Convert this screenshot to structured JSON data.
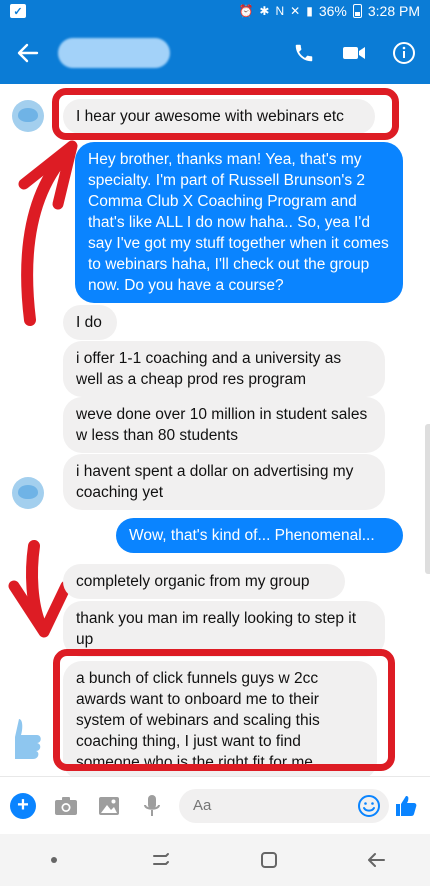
{
  "status_bar": {
    "battery": "36%",
    "time": "3:28 PM"
  },
  "header": {
    "contact_name_hidden": true,
    "icons": [
      "back-arrow-icon",
      "phone-icon",
      "video-camera-icon",
      "info-icon"
    ]
  },
  "messages": [
    {
      "direction": "incoming",
      "text": "I hear your awesome with webinars etc"
    },
    {
      "direction": "outgoing",
      "text": "Hey brother, thanks man!  Yea, that's my specialty.  I'm part of Russell Brunson's 2 Comma Club X Coaching Program and that's like ALL I do now haha..  So, yea I'd say I've got my stuff together when it comes to webinars haha, I'll check out the group now.  Do you have a course?"
    },
    {
      "direction": "incoming",
      "text": "I do"
    },
    {
      "direction": "incoming",
      "text": "i offer 1-1 coaching and a university as well as a cheap prod res program"
    },
    {
      "direction": "incoming",
      "text": "weve done over 10 million in student sales w less than 80 students"
    },
    {
      "direction": "incoming",
      "text": "i havent spent a dollar on advertising my coaching yet"
    },
    {
      "direction": "outgoing",
      "text": "Wow, that's kind of... Phenomenal..."
    },
    {
      "direction": "incoming",
      "text": "completely organic from my group"
    },
    {
      "direction": "incoming",
      "text": "thank you man im really looking to step it up"
    },
    {
      "direction": "incoming",
      "text": "a bunch of click funnels guys w 2cc awards want to onboard me to their system of webinars and scaling this coaching thing, I just want to find someone who is the right fit for me"
    }
  ],
  "composer": {
    "placeholder": "Aa",
    "icons": [
      "plus-icon",
      "camera-icon",
      "image-icon",
      "microphone-icon",
      "emoji-icon",
      "thumbs-up-icon"
    ]
  },
  "colors": {
    "brand_blue": "#0b7cd6",
    "outgoing_bubble": "#0a84ff",
    "incoming_bubble": "#f1f0f0",
    "annotation_red": "#dd1c24"
  }
}
